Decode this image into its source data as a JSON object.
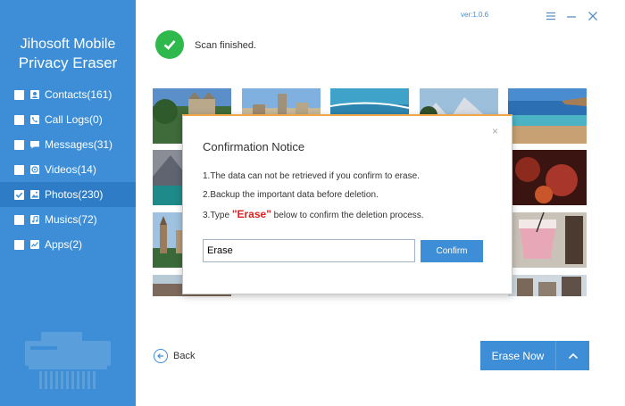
{
  "app": {
    "title_line1": "Jihosoft Mobile",
    "title_line2": "Privacy Eraser",
    "version": "ver:1.0.6"
  },
  "status": {
    "text": "Scan finished."
  },
  "sidebar": {
    "items": [
      {
        "label": "Contacts(161)",
        "icon": "contacts-icon",
        "checked": false
      },
      {
        "label": "Call Logs(0)",
        "icon": "phone-icon",
        "checked": false
      },
      {
        "label": "Messages(31)",
        "icon": "message-icon",
        "checked": false
      },
      {
        "label": "Videos(14)",
        "icon": "video-icon",
        "checked": false
      },
      {
        "label": "Photos(230)",
        "icon": "photo-icon",
        "checked": true
      },
      {
        "label": "Musics(72)",
        "icon": "music-icon",
        "checked": false
      },
      {
        "label": "Apps(2)",
        "icon": "apps-icon",
        "checked": false
      }
    ]
  },
  "modal": {
    "title": "Confirmation Notice",
    "close": "×",
    "line1": "1.The data can not be retrieved if you confirm to erase.",
    "line2": "2.Backup the important data before deletion.",
    "line3_prefix": "3.Type ",
    "line3_keyword": "\"Erase\"",
    "line3_suffix": " below to confirm the deletion process.",
    "input_value": "Erase",
    "confirm_label": "Confirm"
  },
  "footer": {
    "back_label": "Back",
    "erase_now_label": "Erase Now"
  },
  "colors": {
    "primary": "#3d8ed6",
    "success": "#2fb84c",
    "accent": "#f0a64a",
    "keyword": "#e02020"
  }
}
